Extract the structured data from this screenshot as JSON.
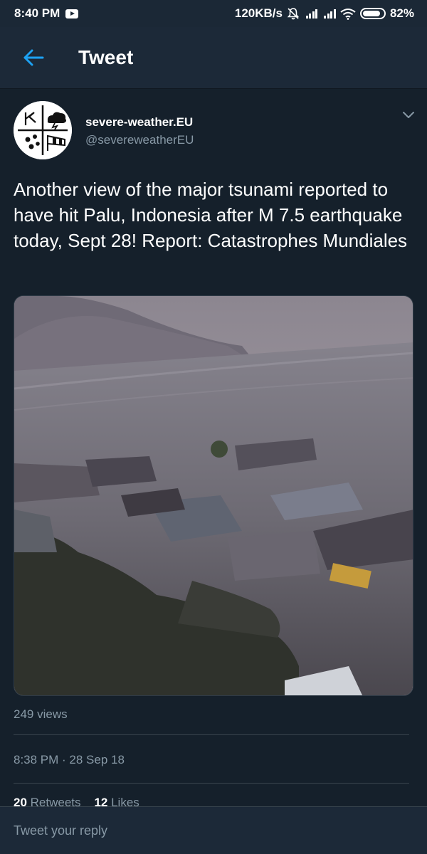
{
  "status_bar": {
    "time": "8:40 PM",
    "network_speed": "120KB/s",
    "battery": "82%",
    "icons": [
      "youtube-icon",
      "mute-icon",
      "signal-icon",
      "signal-icon",
      "wifi-icon",
      "battery-icon"
    ]
  },
  "app_bar": {
    "title": "Tweet",
    "back_icon": "arrow-left-icon"
  },
  "tweet": {
    "author_name": "severe-weather.EU",
    "author_handle": "@severeweatherEU",
    "text": "Another view of the major tsunami reported to have hit Palu, Indonesia after M 7.5 earthquake today, Sept 28! Report: Catastrophes Mundiales",
    "views": "249 views",
    "timestamp": "8:38 PM · 28 Sep 18",
    "retweets_count": "20",
    "retweets_label": "Retweets",
    "likes_count": "12",
    "likes_label": "Likes"
  },
  "reply": {
    "placeholder": "Tweet your reply"
  },
  "colors": {
    "background": "#15202b",
    "bar": "#1c2938",
    "accent": "#1da1f2",
    "secondary_text": "#8899a6"
  }
}
